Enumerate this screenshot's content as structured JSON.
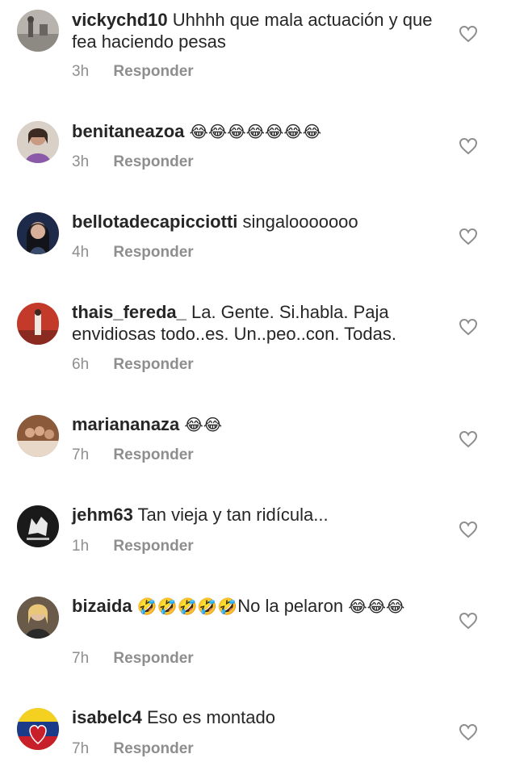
{
  "reply_label": "Responder",
  "colors": {
    "text": "#262626",
    "meta": "#8e8e8e",
    "background": "#ffffff"
  },
  "comments": [
    {
      "username": "vickychd10",
      "text": "Uhhhh que mala actuación y que fea haciendo pesas",
      "emoji": "",
      "time": "3h",
      "avatar_icon": "avatar-photo-icon"
    },
    {
      "username": "benitaneazoa",
      "text": "",
      "emoji": "😂😂😂😂😂😂😂",
      "time": "3h",
      "avatar_icon": "avatar-photo-icon"
    },
    {
      "username": "bellotadecapicciotti",
      "text": "singalooooooo",
      "emoji": "",
      "time": "4h",
      "avatar_icon": "avatar-photo-icon"
    },
    {
      "username": "thais_fereda_",
      "text": "La. Gente. Si.habla. Paja envidiosas todo..es. Un..peo..con. Todas.",
      "emoji": "",
      "time": "6h",
      "avatar_icon": "avatar-photo-icon"
    },
    {
      "username": "mariananaza",
      "text": "",
      "emoji": "😂😂",
      "time": "7h",
      "avatar_icon": "avatar-photo-icon"
    },
    {
      "username": "jehm63",
      "text": "Tan vieja y tan ridícula...",
      "emoji": "",
      "time": "1h",
      "avatar_icon": "wolf-logo-icon"
    },
    {
      "username": "bizaida",
      "text": "No la pelaron",
      "emoji": "🤣🤣🤣🤣🤣",
      "emoji_after": "😂😂😂",
      "time": "7h",
      "avatar_icon": "avatar-photo-icon"
    },
    {
      "username": "isabelc4",
      "text": "Eso es montado",
      "emoji": "",
      "time": "7h",
      "avatar_icon": "flag-heart-icon"
    }
  ]
}
